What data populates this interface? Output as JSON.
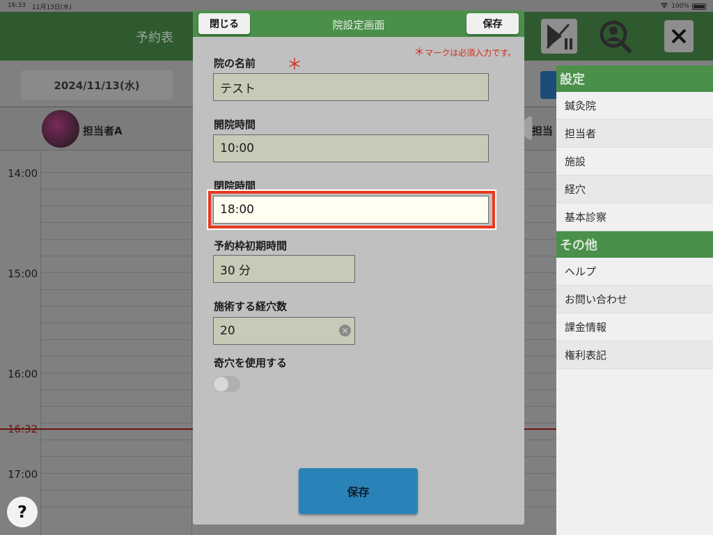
{
  "status_bar": {
    "time": "16:33",
    "date": "11月13日(水)",
    "battery": "100%"
  },
  "app": {
    "title": "予約表"
  },
  "calendar": {
    "date_button": "2024/11/13(水)",
    "staff": [
      "担当者A",
      "担当"
    ],
    "time_labels": [
      "14:00",
      "15:00",
      "16:00",
      "17:00"
    ],
    "current_time": "16:32"
  },
  "help": {
    "label": "?"
  },
  "side_menu": {
    "sections": [
      {
        "header": "設定",
        "items": [
          "鍼灸院",
          "担当者",
          "施設",
          "経穴",
          "基本診察"
        ]
      },
      {
        "header": "その他",
        "items": [
          "ヘルプ",
          "お問い合わせ",
          "課金情報",
          "権利表記"
        ]
      }
    ]
  },
  "modal": {
    "title": "院設定画面",
    "close_label": "閉じる",
    "save_label": "保存",
    "required_note": "マークは必須入力です。",
    "required_star": "＊",
    "fields": {
      "clinic_name": {
        "label": "院の名前",
        "value": "テスト"
      },
      "open_time": {
        "label": "開院時間",
        "value": "10:00"
      },
      "close_time": {
        "label": "閉院時間",
        "value": "18:00"
      },
      "slot_time": {
        "label": "予約枠初期時間",
        "value": "30 分"
      },
      "acupoints": {
        "label": "施術する経穴数",
        "value": "20"
      },
      "odd_points": {
        "label": "奇穴を使用する",
        "enabled": false
      }
    },
    "bottom_save_label": "保存"
  },
  "colors": {
    "accent_green": "#4a8f4a",
    "primary_blue": "#2a83b8",
    "required_red": "#d42a1a",
    "focus_red": "#e8391f"
  }
}
